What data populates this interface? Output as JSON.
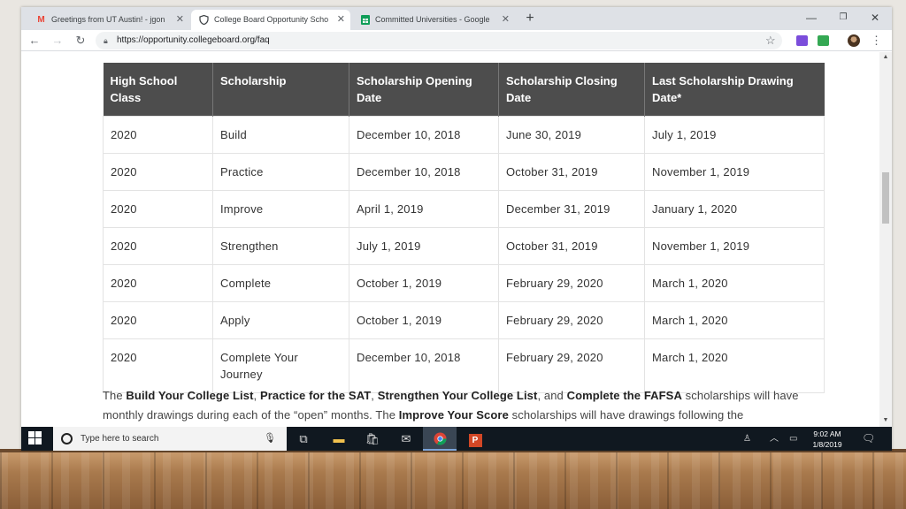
{
  "browser": {
    "tabs": [
      {
        "title": "Greetings from UT Austin! - jgon",
        "icon": "gmail-icon",
        "icon_color": "#ea4335",
        "active": false
      },
      {
        "title": "College Board Opportunity Scho",
        "icon": "shield-favicon",
        "icon_color": "#3c4043",
        "active": true
      },
      {
        "title": "Committed Universities - Google",
        "icon": "sheets-icon",
        "icon_color": "#0f9d58",
        "active": false
      }
    ],
    "url": "https://opportunity.collegeboard.org/faq"
  },
  "table": {
    "headers": [
      "High School Class",
      "Scholarship",
      "Scholarship Opening Date",
      "Scholarship Closing Date",
      "Last Scholarship Drawing Date*"
    ],
    "rows": [
      [
        "2020",
        "Build",
        "December 10, 2018",
        "June 30, 2019",
        "July 1, 2019"
      ],
      [
        "2020",
        "Practice",
        "December 10, 2018",
        "October 31, 2019",
        "November 1, 2019"
      ],
      [
        "2020",
        "Improve",
        "April 1, 2019",
        "December 31, 2019",
        "January 1, 2020"
      ],
      [
        "2020",
        "Strengthen",
        "July 1, 2019",
        "October 31, 2019",
        "November 1, 2019"
      ],
      [
        "2020",
        "Complete",
        "October 1, 2019",
        "February 29, 2020",
        "March 1, 2020"
      ],
      [
        "2020",
        "Apply",
        "October 1, 2019",
        "February 29, 2020",
        "March 1, 2020"
      ],
      [
        "2020",
        "Complete Your Journey",
        "December 10, 2018",
        "February 29, 2020",
        "March 1, 2020"
      ]
    ]
  },
  "paragraph": {
    "t1": "The ",
    "b1": "Build Your College List",
    "t2": ", ",
    "b2": "Practice for the SAT",
    "t3": ", ",
    "b3": "Strengthen Your College List",
    "t4": ", and ",
    "b4": "Complete the FAFSA",
    "t5": " scholarships will have monthly drawings during each of the “open” months. The ",
    "b5": "Improve Your Score",
    "t6": " scholarships will have drawings following the"
  },
  "taskbar": {
    "search_placeholder": "Type here to search",
    "time": "9:02 AM",
    "date": "1/8/2019"
  },
  "colors": {
    "table_header_bg": "#4d4d4d",
    "taskbar_bg": "#101820"
  }
}
